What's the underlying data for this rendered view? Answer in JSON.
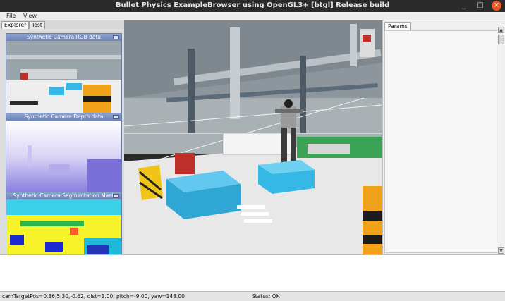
{
  "window": {
    "title": "Bullet Physics ExampleBrowser using OpenGL3+ [btgl] Release build",
    "minimize_glyph": "_",
    "maximize_glyph": "□",
    "close_glyph": "×"
  },
  "menu": {
    "file": "File",
    "view": "View"
  },
  "left_tabs": {
    "explorer": "Explorer",
    "test": "Test"
  },
  "camera_windows": {
    "rgb": {
      "title": "Synthetic Camera RGB data"
    },
    "depth": {
      "title": "Synthetic Camera Depth data"
    },
    "segmentation": {
      "title": "Synthetic Camera Segmentation Mask"
    }
  },
  "params": {
    "tab": "Params",
    "scroll_up": "▲",
    "scroll_down": "▼"
  },
  "status": {
    "camera": "camTargetPos=0.36,5.30,-0.62, dist=1.00, pitch=-9.00, yaw=148.00",
    "state": "Status: OK"
  },
  "colors": {
    "title_bar": "#2b2b2b",
    "close_button": "#e95420",
    "floor": "#e8e8e8",
    "cyan_box": "#35b8e6",
    "orange_barrel": "#f0a21a"
  },
  "icons": [
    "minimize-icon",
    "maximize-icon",
    "close-icon",
    "chevron-up-icon",
    "chevron-down-icon"
  ]
}
